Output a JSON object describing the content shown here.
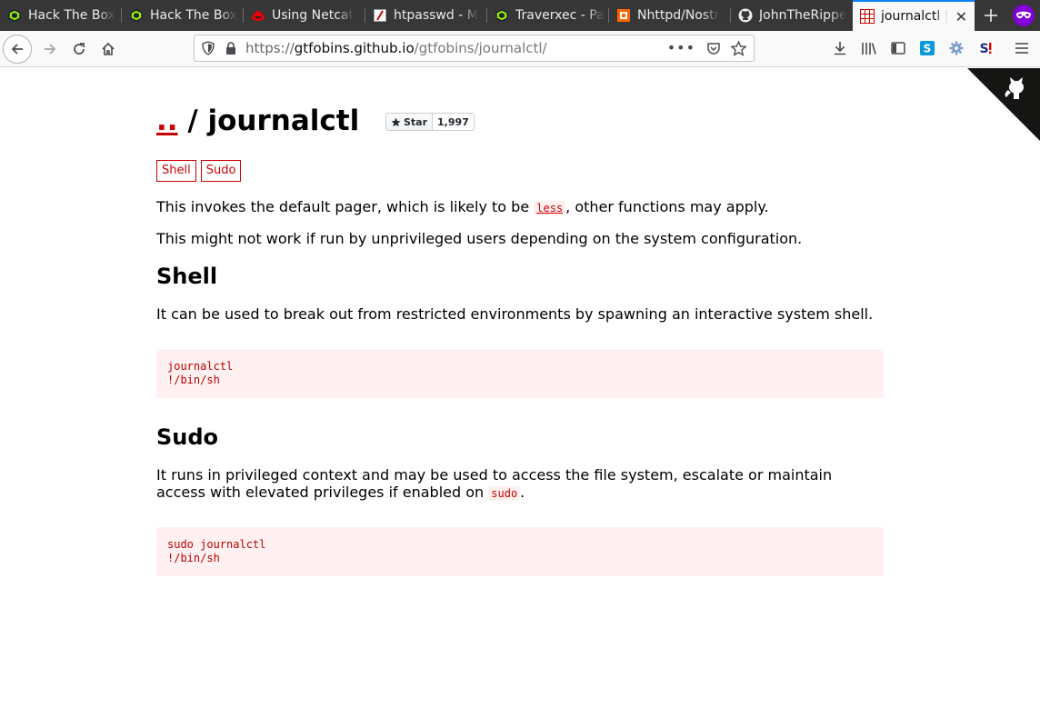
{
  "tabs": [
    {
      "label": "Hack The Box",
      "icon": "hackthebox-icon"
    },
    {
      "label": "Hack The Box",
      "icon": "hackthebox-icon"
    },
    {
      "label": "Using Netcat",
      "icon": "redhat-icon"
    },
    {
      "label": "htpasswd - M",
      "icon": "htpasswd-icon"
    },
    {
      "label": "Traverxec - Pa",
      "icon": "hackthebox-icon"
    },
    {
      "label": "Nhttpd/Nostr",
      "icon": "orange-square-icon"
    },
    {
      "label": "JohnTheRippe",
      "icon": "github-icon"
    },
    {
      "label": "journalctl | ",
      "icon": "gtfobins-icon",
      "active": true
    }
  ],
  "url": {
    "scheme": "https://",
    "host": "gtfobins.github.io",
    "path": "/gtfobins/journalctl/"
  },
  "page": {
    "dots": "..",
    "slash": " / ",
    "binary": "journalctl",
    "star_label": "Star",
    "star_count": "1,997",
    "tags": [
      "Shell",
      "Sudo"
    ],
    "intro1_a": "This invokes the default pager, which is likely to be ",
    "intro1_code": "less",
    "intro1_b": ", other functions may apply.",
    "intro2": "This might not work if run by unprivileged users depending on the system configuration.",
    "shell_heading": "Shell",
    "shell_desc": "It can be used to break out from restricted environments by spawning an interactive system shell.",
    "shell_code": "journalctl\n!/bin/sh",
    "sudo_heading": "Sudo",
    "sudo_desc_a": "It runs in privileged context and may be used to access the file system, escalate or maintain access with elevated privileges if enabled on ",
    "sudo_desc_code": "sudo",
    "sudo_desc_b": ".",
    "sudo_code": "sudo journalctl\n!/bin/sh"
  },
  "colors": {
    "accent": "#cc0000",
    "code_bg": "#fff1f1",
    "tabbar": "#373737"
  }
}
